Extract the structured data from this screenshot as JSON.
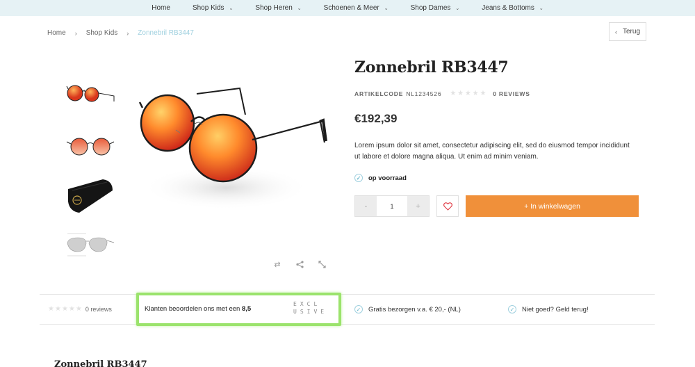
{
  "nav": {
    "items": [
      {
        "label": "Home",
        "has_dropdown": false
      },
      {
        "label": "Shop Kids",
        "has_dropdown": true
      },
      {
        "label": "Shop Heren",
        "has_dropdown": true
      },
      {
        "label": "Schoenen & Meer",
        "has_dropdown": true
      },
      {
        "label": "Shop Dames",
        "has_dropdown": true
      },
      {
        "label": "Jeans & Bottoms",
        "has_dropdown": true
      }
    ]
  },
  "breadcrumb": {
    "items": [
      "Home",
      "Shop Kids"
    ],
    "current": "Zonnebril RB3447"
  },
  "back_button": {
    "label": "Terug",
    "icon": "chevron-left-icon"
  },
  "gallery": {
    "thumbnails": [
      "sunglasses-angle",
      "sunglasses-front",
      "sunglasses-case",
      "sunglasses-diagram"
    ],
    "tools": [
      "compare-icon",
      "share-icon",
      "expand-icon"
    ]
  },
  "product": {
    "title": "Zonnebril RB3447",
    "sku_label": "ARTIKELCODE",
    "sku": "NL1234526",
    "rating": 0,
    "reviews_label": "0 REVIEWS",
    "price": "€192,39",
    "description": "Lorem ipsum dolor sit amet, consectetur adipiscing elit, sed do eiusmod tempor incididunt ut labore et dolore magna aliqua. Ut enim ad minim veniam.",
    "stock": "op voorraad",
    "quantity_minus": "-",
    "quantity": "1",
    "quantity_plus": "+",
    "add_to_cart": "+ In winkelwagen"
  },
  "usp_bar": {
    "reviews_label": "0 reviews",
    "rating_prefix": "Klanten beoordelen ons met een",
    "rating_score": "8,5",
    "logo_line1": "EXCL",
    "logo_line2": "USIVE",
    "usp1": "Gratis bezorgen v.a. € 20,- (NL)",
    "usp2": "Niet goed? Geld terug!"
  },
  "bottom_title": "Zonnebril RB3447",
  "colors": {
    "accent": "#f0903a",
    "nav_bg": "#e6f2f5",
    "check": "#9fd0df",
    "highlight": "#9be36c"
  }
}
